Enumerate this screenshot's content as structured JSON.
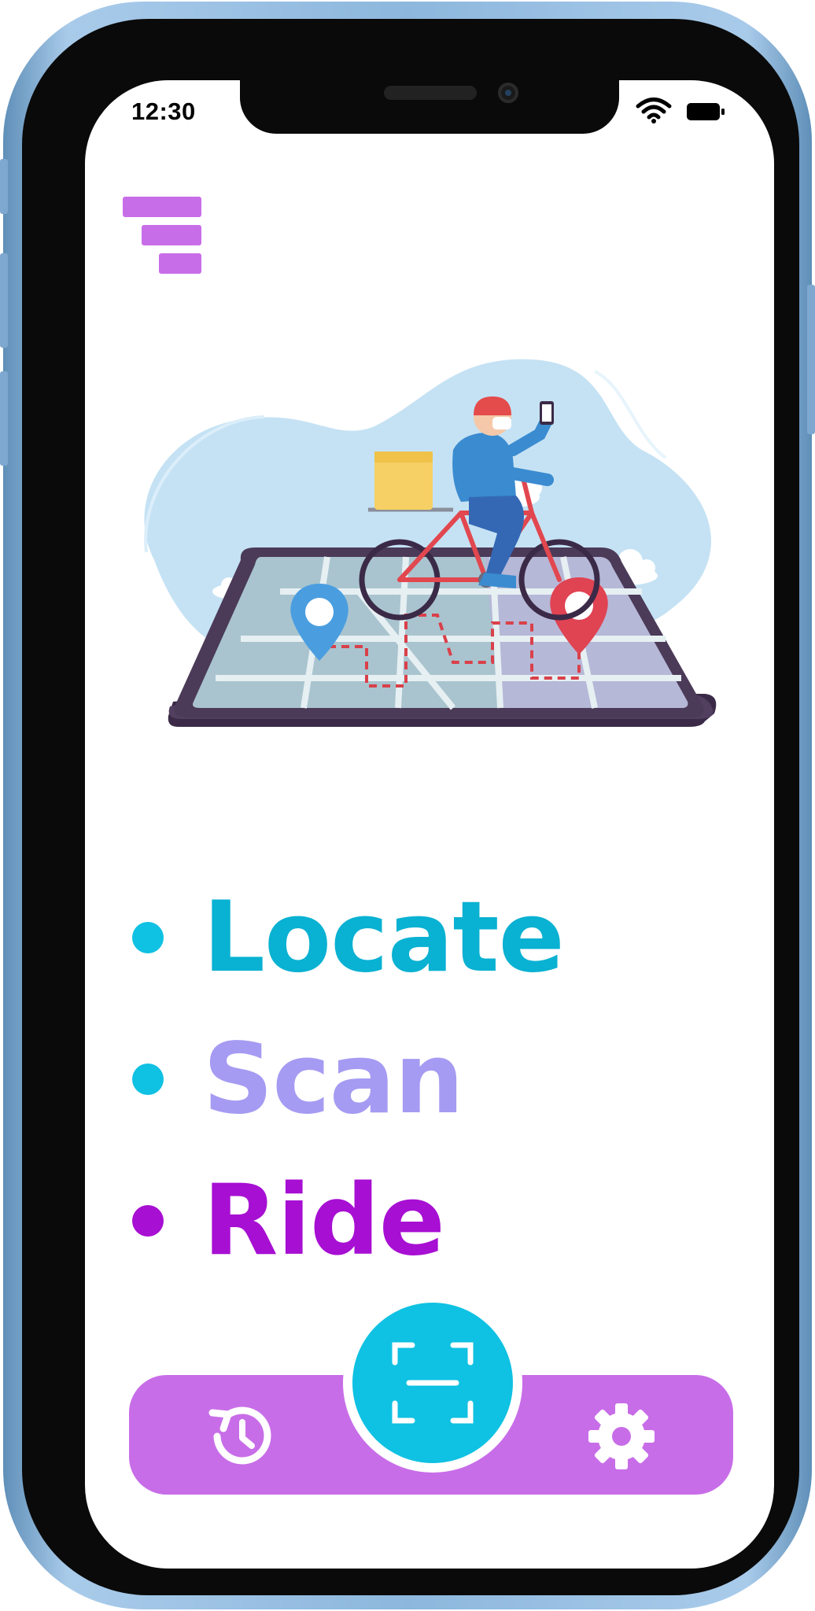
{
  "status_bar": {
    "time": "12:30",
    "wifi_icon": "wifi-icon",
    "battery_icon": "battery-icon"
  },
  "header": {
    "menu_icon": "menu-filter-icon"
  },
  "hero": {
    "illustration": "delivery-rider-on-bicycle-over-phone-map"
  },
  "features": [
    {
      "label": "Locate",
      "bullet_color": "#0fc1e2",
      "text_color": "#09b1d2"
    },
    {
      "label": "Scan",
      "bullet_color": "#0fc1e2",
      "text_color": "#a59bf2"
    },
    {
      "label": "Ride",
      "bullet_color": "#a70fd3",
      "text_color": "#a70fd3"
    }
  ],
  "bottom_nav": {
    "history_icon": "history-icon",
    "scan_icon": "qr-scan-icon",
    "settings_icon": "gear-icon"
  },
  "colors": {
    "accent_purple": "#c86de8",
    "accent_cyan": "#0fc1e2",
    "device_frame": "#8db7dd"
  }
}
